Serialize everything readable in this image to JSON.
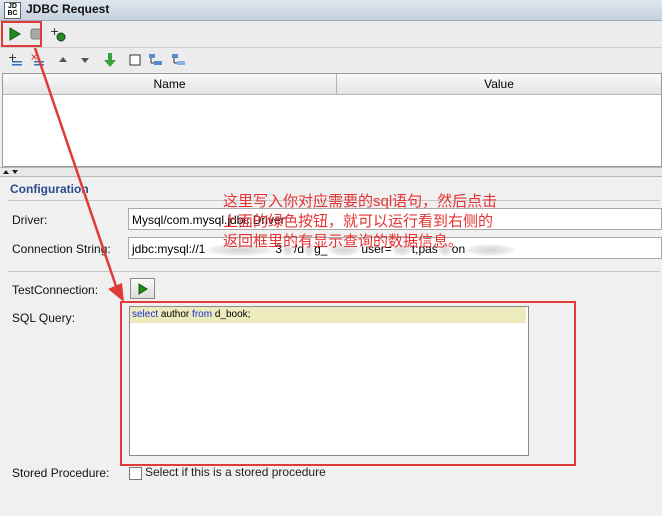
{
  "window": {
    "title": "JDBC Request",
    "app_icon": "JD\nBC"
  },
  "toolbar_top": [
    {
      "name": "run",
      "icon": "play-triangle-icon",
      "color": "#1f8a1f"
    },
    {
      "name": "stop",
      "icon": "stop-square-icon",
      "color": "#9a9a9a"
    },
    {
      "name": "add-bug",
      "icon": "add-bug-icon"
    }
  ],
  "table": {
    "columns": [
      "Name",
      "Value"
    ]
  },
  "config": {
    "title": "Configuration",
    "driver_label": "Driver:",
    "driver_value": "Mysql/com.mysql.jdbc.Driver",
    "connection_label": "Connection String:",
    "connection_value": "jdbc:mysql://1",
    "connection_part2": "3",
    "connection_part3": "/d",
    "connection_part4": "g_",
    "connection_part5": "user=",
    "connection_part6": "t;pas",
    "connection_part7": "on",
    "test_label": "TestConnection:",
    "sql_label": "SQL Query:",
    "sql_kw1": "select",
    "sql_text1": " author ",
    "sql_kw2": " from",
    "sql_text2": " d_book;",
    "stored_label": "Stored Procedure:",
    "stored_checkbox_label": "Select if this is a stored procedure"
  },
  "annotation": {
    "line1": "这里写入你对应需要的sql语句，然后点击",
    "line2": "上面的绿色按钮，就可以运行看到右侧的",
    "line3": "返回框里的有显示查询的数据信息。",
    "color": "#e03a3a"
  }
}
